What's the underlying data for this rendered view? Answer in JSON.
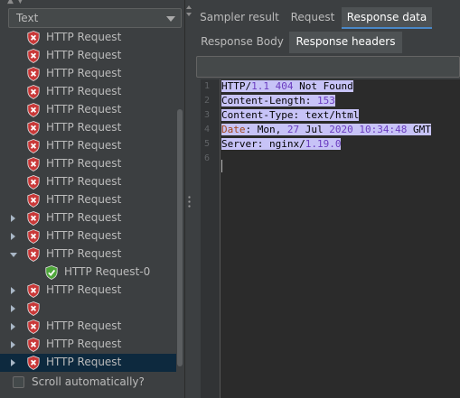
{
  "left": {
    "format_select": {
      "value": "Text"
    },
    "tree_rows": [
      {
        "label": "HTTP Request",
        "status": "error",
        "expander": "none",
        "depth": 0
      },
      {
        "label": "HTTP Request",
        "status": "error",
        "expander": "none",
        "depth": 0
      },
      {
        "label": "HTTP Request",
        "status": "error",
        "expander": "none",
        "depth": 0
      },
      {
        "label": "HTTP Request",
        "status": "error",
        "expander": "none",
        "depth": 0
      },
      {
        "label": "HTTP Request",
        "status": "error",
        "expander": "none",
        "depth": 0
      },
      {
        "label": "HTTP Request",
        "status": "error",
        "expander": "none",
        "depth": 0
      },
      {
        "label": "HTTP Request",
        "status": "error",
        "expander": "none",
        "depth": 0
      },
      {
        "label": "HTTP Request",
        "status": "error",
        "expander": "none",
        "depth": 0
      },
      {
        "label": "HTTP Request",
        "status": "error",
        "expander": "none",
        "depth": 0
      },
      {
        "label": "HTTP Request",
        "status": "error",
        "expander": "none",
        "depth": 0
      },
      {
        "label": "HTTP Request",
        "status": "error",
        "expander": "collapsed",
        "depth": 0
      },
      {
        "label": "HTTP Request",
        "status": "error",
        "expander": "collapsed",
        "depth": 0
      },
      {
        "label": "HTTP Request",
        "status": "error",
        "expander": "expanded",
        "depth": 0
      },
      {
        "label": "HTTP Request-0",
        "status": "success",
        "expander": "none",
        "depth": 1
      },
      {
        "label": "HTTP Request",
        "status": "error",
        "expander": "collapsed",
        "depth": 0
      },
      {
        "label": "",
        "status": "error",
        "expander": "collapsed",
        "depth": 0
      },
      {
        "label": "HTTP Request",
        "status": "error",
        "expander": "collapsed",
        "depth": 0
      },
      {
        "label": "HTTP Request",
        "status": "error",
        "expander": "collapsed",
        "depth": 0
      },
      {
        "label": "HTTP Request",
        "status": "error",
        "expander": "collapsed",
        "depth": 0,
        "selected": true
      }
    ],
    "scroll_auto": {
      "label": "Scroll automatically?",
      "checked": false
    }
  },
  "right": {
    "tabs": [
      "Sampler result",
      "Request",
      "Response data"
    ],
    "active_tab": "Response data",
    "subtabs": [
      "Response Body",
      "Response headers"
    ],
    "active_subtab": "Response headers",
    "search_value": "",
    "line_numbers": [
      "1",
      "2",
      "3",
      "4",
      "5",
      "6"
    ],
    "code_lines": [
      [
        {
          "t": "HTTP/"
        },
        {
          "t": "1.1",
          "c": "num"
        },
        {
          "t": " "
        },
        {
          "t": "404",
          "c": "num"
        },
        {
          "t": " Not Found"
        }
      ],
      [
        {
          "t": "Content-Length: "
        },
        {
          "t": "153",
          "c": "num"
        }
      ],
      [
        {
          "t": "Content-Type: text/html"
        }
      ],
      [
        {
          "t": "Date",
          "c": "dt"
        },
        {
          "t": ": Mon, "
        },
        {
          "t": "27",
          "c": "num"
        },
        {
          "t": " Jul "
        },
        {
          "t": "2020",
          "c": "num"
        },
        {
          "t": " "
        },
        {
          "t": "10:34:48",
          "c": "num"
        },
        {
          "t": " GMT"
        }
      ],
      [
        {
          "t": "Server: nginx/"
        },
        {
          "t": "1.19.0",
          "c": "num"
        }
      ],
      []
    ]
  },
  "colors": {
    "panel_bg": "#3c3f41",
    "editor_bg": "#2b2b2b",
    "selection_bg": "#0d293e",
    "highlight_bg": "#c7c3f7",
    "active_tab_underline": "#4a88c7",
    "error_icon": "#c93838",
    "success_icon": "#4ea63a"
  }
}
